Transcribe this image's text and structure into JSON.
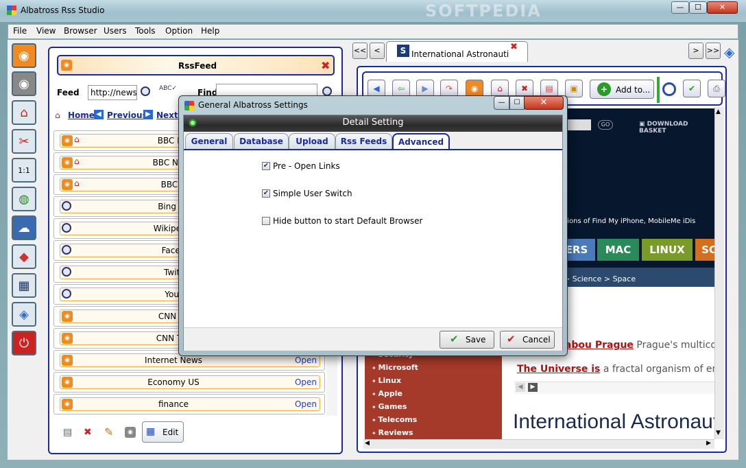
{
  "window": {
    "title": "Albatross Rss Studio",
    "min": "—",
    "max": "☐",
    "close": "✕"
  },
  "menu": [
    "File",
    "View",
    "Browser",
    "Users",
    "Tools",
    "Option",
    "Help"
  ],
  "feed_panel": {
    "title": "RssFeed",
    "feed_label": "Feed",
    "feed_value": "http://news.",
    "find_label": "Find",
    "nav": {
      "home": "Home",
      "previous": "Previous",
      "next": "Next"
    },
    "rows": [
      {
        "label": "BBC Fro",
        "open": ""
      },
      {
        "label": "BBC News",
        "open": ""
      },
      {
        "label": "BBC  B",
        "open": ""
      },
      {
        "label": "Bing Se",
        "open": ""
      },
      {
        "label": "Wikipedia",
        "open": ""
      },
      {
        "label": "Faceb",
        "open": ""
      },
      {
        "label": "Twitt",
        "open": ""
      },
      {
        "label": "Yout",
        "open": ""
      },
      {
        "label": "CNN Pe",
        "open": ""
      },
      {
        "label": "CNN Top",
        "open": ""
      },
      {
        "label": "Internet News",
        "open": "Open"
      },
      {
        "label": "Economy US",
        "open": "Open"
      },
      {
        "label": "finance",
        "open": "Open"
      }
    ],
    "edit_label": "Edit"
  },
  "browser": {
    "tab_title": "International Astronautic...",
    "nav_first": "<<",
    "nav_prev": "<",
    "nav_next": ">",
    "nav_last": ">>",
    "add_to": "Add to...",
    "web": {
      "go": "GO",
      "download_basket": "DOWNLOAD BASKET",
      "news_snippet": "sions of Find My iPhone, MobileMe iDis",
      "tabs": [
        "ERS",
        "MAC",
        "LINUX",
        "SC"
      ],
      "breadcrumb": "> Science > Space",
      "link1": "rabou Prague",
      "link1_text": " Prague's multicolou",
      "link2": "The Universe is",
      "link2_text": " a fractal organism of energy",
      "sidebar": [
        "Security",
        "Microsoft",
        "Linux",
        "Apple",
        "Games",
        "Telecoms",
        "Reviews"
      ],
      "headline": "International Astronaut"
    }
  },
  "dialog": {
    "title": "General Albatross Settings",
    "header": "Detail Setting",
    "tabs": [
      "General",
      "Database",
      "Upload",
      "Rss Feeds",
      "Advanced"
    ],
    "active_tab": "Advanced",
    "options": [
      {
        "label": "Pre - Open Links",
        "checked": true
      },
      {
        "label": "Simple User Switch",
        "checked": true
      },
      {
        "label": "Hide button to start Default Browser",
        "checked": false
      }
    ],
    "save": "Save",
    "cancel": "Cancel"
  },
  "watermark": "SOFTPEDIA"
}
